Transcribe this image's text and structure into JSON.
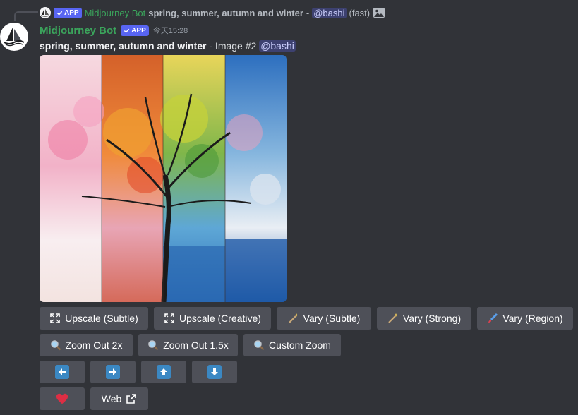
{
  "reply": {
    "bot_name": "Midjourney Bot",
    "badge": "APP",
    "prompt": "spring, summer, autumn and winter",
    "separator": "-",
    "mention": "@bashi",
    "speed": "(fast)",
    "attachment_icon": "image-icon"
  },
  "message": {
    "author": "Midjourney Bot",
    "badge": "APP",
    "timestamp": "今天15:28",
    "prompt": "spring, summer, autumn and winter",
    "suffix": " - Image #2 ",
    "mention": "@bashi"
  },
  "image": {
    "description_colors": [
      "#f0a8c0",
      "#e8742c",
      "#f2c84a",
      "#3a8ad6"
    ]
  },
  "buttons": {
    "row1": [
      {
        "label": "Upscale (Subtle)",
        "icon": "expand-icon"
      },
      {
        "label": "Upscale (Creative)",
        "icon": "expand-icon"
      },
      {
        "label": "Vary (Subtle)",
        "icon": "magic-wand-icon"
      },
      {
        "label": "Vary (Strong)",
        "icon": "magic-wand-icon"
      },
      {
        "label": "Vary (Region)",
        "icon": "paintbrush-icon"
      }
    ],
    "row2": [
      {
        "label": "Zoom Out 2x",
        "icon": "magnifier-icon"
      },
      {
        "label": "Zoom Out 1.5x",
        "icon": "magnifier-icon"
      },
      {
        "label": "Custom Zoom",
        "icon": "magnifier-icon"
      }
    ],
    "row3": [
      {
        "icon": "arrow-left-icon"
      },
      {
        "icon": "arrow-right-icon"
      },
      {
        "icon": "arrow-up-icon"
      },
      {
        "icon": "arrow-down-icon"
      }
    ],
    "row4": [
      {
        "icon": "heart-icon"
      },
      {
        "label": "Web",
        "icon": "external-link-icon"
      }
    ]
  },
  "colors": {
    "background": "#313338",
    "button": "#4e5058",
    "bot_name": "#3ba55c",
    "badge": "#5865f2",
    "arrow_box": "#3b88c3",
    "heart": "#dd2e44"
  }
}
